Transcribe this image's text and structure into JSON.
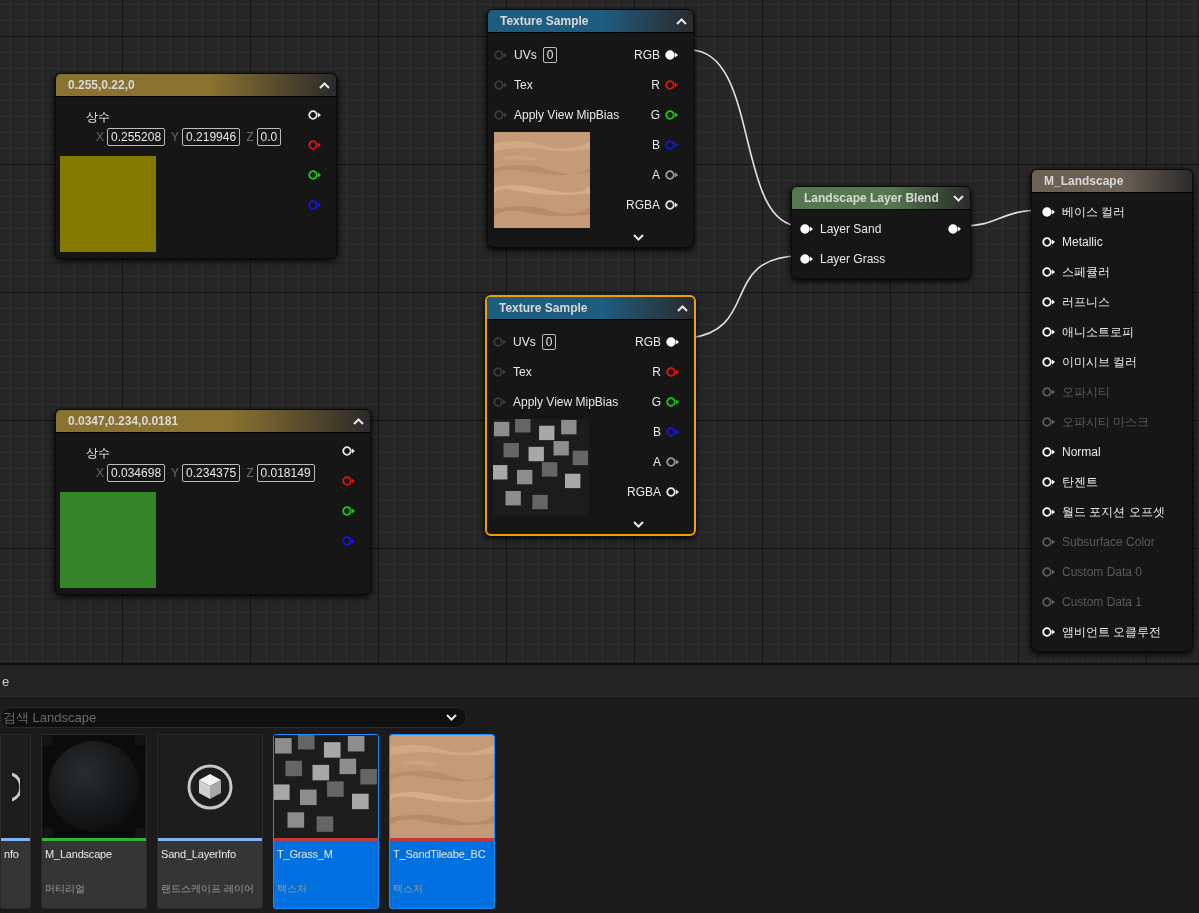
{
  "constant_nodes": [
    {
      "title": "0.255,0.22,0",
      "label": "상수",
      "fields": [
        {
          "axis": "X",
          "value": "0.255208"
        },
        {
          "axis": "Y",
          "value": "0.219946"
        },
        {
          "axis": "Z",
          "value": "0.0"
        }
      ],
      "color": "#857a00",
      "outputs": [
        {
          "color": "#e6e6e6"
        },
        {
          "color": "#e01414"
        },
        {
          "color": "#14d014"
        },
        {
          "color": "#1414e6"
        }
      ]
    },
    {
      "title": "0.0347,0.234,0.0181",
      "label": "상수",
      "fields": [
        {
          "axis": "X",
          "value": "0.034698"
        },
        {
          "axis": "Y",
          "value": "0.234375"
        },
        {
          "axis": "Z",
          "value": "0.018149"
        }
      ],
      "color": "#36842a",
      "outputs": [
        {
          "color": "#e6e6e6"
        },
        {
          "color": "#e01414"
        },
        {
          "color": "#14d014"
        },
        {
          "color": "#1414e6"
        }
      ]
    }
  ],
  "texture_samples": [
    {
      "title": "Texture Sample",
      "selected": false,
      "preview": {
        "kind": "sand"
      },
      "inputs": [
        {
          "label": "UVs",
          "value": "0"
        },
        {
          "label": "Tex"
        },
        {
          "label": "Apply View MipBias"
        }
      ],
      "outputs": [
        {
          "label": "RGB",
          "color": "#ffffff",
          "connected": true
        },
        {
          "label": "R",
          "color": "#e01414",
          "connected": false
        },
        {
          "label": "G",
          "color": "#14d014",
          "connected": false
        },
        {
          "label": "B",
          "color": "#1414e6",
          "connected": false
        },
        {
          "label": "A",
          "color": "#9a9a9a",
          "connected": false
        },
        {
          "label": "RGBA",
          "color": "#e6e6e6",
          "connected": false
        }
      ]
    },
    {
      "title": "Texture Sample",
      "selected": true,
      "preview": {
        "kind": "speckle"
      },
      "inputs": [
        {
          "label": "UVs",
          "value": "0"
        },
        {
          "label": "Tex"
        },
        {
          "label": "Apply View MipBias"
        }
      ],
      "outputs": [
        {
          "label": "RGB",
          "color": "#ffffff",
          "connected": true
        },
        {
          "label": "R",
          "color": "#e01414",
          "connected": false
        },
        {
          "label": "G",
          "color": "#14d014",
          "connected": false
        },
        {
          "label": "B",
          "color": "#1414e6",
          "connected": false
        },
        {
          "label": "A",
          "color": "#9a9a9a",
          "connected": false
        },
        {
          "label": "RGBA",
          "color": "#e6e6e6",
          "connected": false
        }
      ]
    }
  ],
  "blend_node": {
    "title": "Landscape Layer Blend",
    "inputs": [
      {
        "label": "Layer Sand",
        "connected": true
      },
      {
        "label": "Layer Grass",
        "connected": true
      }
    ],
    "output_connected": true
  },
  "material_node": {
    "title": "M_Landscape",
    "inputs": [
      {
        "label": "베이스 컬러",
        "connected": true,
        "disabled": false
      },
      {
        "label": "Metallic",
        "connected": false,
        "disabled": false
      },
      {
        "label": "스페큘러",
        "connected": false,
        "disabled": false
      },
      {
        "label": "러프니스",
        "connected": false,
        "disabled": false
      },
      {
        "label": "애니소트로피",
        "connected": false,
        "disabled": false
      },
      {
        "label": "이미시브 컬러",
        "connected": false,
        "disabled": false
      },
      {
        "label": "오파시티",
        "connected": false,
        "disabled": true
      },
      {
        "label": "오파시티 마스크",
        "connected": false,
        "disabled": true
      },
      {
        "label": "Normal",
        "connected": false,
        "disabled": false
      },
      {
        "label": "탄젠트",
        "connected": false,
        "disabled": false
      },
      {
        "label": "월드 포지션 오프셋",
        "connected": false,
        "disabled": false
      },
      {
        "label": "Subsurface Color",
        "connected": false,
        "disabled": true
      },
      {
        "label": "Custom Data 0",
        "connected": false,
        "disabled": true
      },
      {
        "label": "Custom Data 1",
        "connected": false,
        "disabled": true
      },
      {
        "label": "앰비언트 오클루전",
        "connected": false,
        "disabled": false
      }
    ]
  },
  "content_browser": {
    "tab_title": "e",
    "search": {
      "placeholder": "검색 Landscape"
    },
    "assets": [
      {
        "name": "nfo",
        "thumb": {
          "kind": "info"
        },
        "color": "#7fb2ee",
        "selected": false
      },
      {
        "name": "M_Landscape",
        "type": "머티리얼",
        "thumb": {
          "kind": "material"
        },
        "color": "#34b234",
        "selected": false
      },
      {
        "name": "Sand_LayerInfo",
        "type": "랜드스케이프 레이어",
        "thumb": {
          "kind": "layer"
        },
        "color": "#7fb2ee",
        "selected": false
      },
      {
        "name": "T_Grass_M",
        "type": "텍스처",
        "thumb": {
          "kind": "speckle"
        },
        "color": "#c03a3a",
        "selected": true
      },
      {
        "name": "T_SandTileabe_BC",
        "type": "텍스처",
        "thumb": {
          "kind": "sand"
        },
        "color": "#c03a3a",
        "selected": true
      }
    ]
  }
}
